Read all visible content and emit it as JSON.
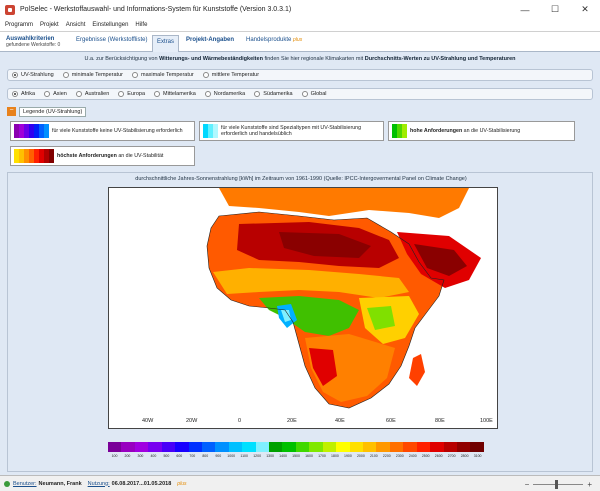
{
  "window": {
    "title": "PolSelec - Werkstoffauswahl- und Informations-System für Kunststoffe (Version 3.0.3.1)",
    "minimize": "—",
    "maximize": "☐",
    "close": "✕"
  },
  "menu": [
    "Programm",
    "Projekt",
    "Ansicht",
    "Einstellungen",
    "Hilfe"
  ],
  "tabs": [
    {
      "label": "Auswahlkriterien",
      "sub": "gefundene Werkstoffe: 0"
    },
    {
      "label": "Ergebnisse (Werkstoffliste)"
    },
    {
      "label": "Extras"
    },
    {
      "label": "Projekt-Angaben"
    },
    {
      "label": "Handelsprodukte",
      "plus": "plus"
    }
  ],
  "info": {
    "pre": "U.a. zur Berücksichtigung von ",
    "b1": "Witterungs- und Wärmebeständigkeiten",
    "mid": " finden Sie hier regionale Klimakarten mit ",
    "b2": "Durchschnitts-Werten zu UV-Strahlung und Temperaturen"
  },
  "measure_options": [
    {
      "label": "UV-Strahlung",
      "selected": true
    },
    {
      "label": "minimale Temperatur",
      "selected": false
    },
    {
      "label": "maximale Temperatur",
      "selected": false
    },
    {
      "label": "mittlere Temperatur",
      "selected": false
    }
  ],
  "region_options": [
    {
      "label": "Afrika",
      "selected": true
    },
    {
      "label": "Asien",
      "selected": false
    },
    {
      "label": "Australien",
      "selected": false
    },
    {
      "label": "Europa",
      "selected": false
    },
    {
      "label": "Mittelamerika",
      "selected": false
    },
    {
      "label": "Nordamerika",
      "selected": false
    },
    {
      "label": "Südamerika",
      "selected": false
    },
    {
      "label": "Global",
      "selected": false
    }
  ],
  "legend": {
    "toggle": "−",
    "title": "Legende (UV-Strahlung)",
    "items": [
      {
        "text": "für viele Kunststoffe keine UV-Stabilisierung erforderlich",
        "colors": [
          "#8b00b0",
          "#a000d8",
          "#6a00e8",
          "#3000f0",
          "#0020f8",
          "#0060ff",
          "#0090ff"
        ]
      },
      {
        "text": "für viele Kunststoffe sind Spezialtypen mit UV-Stabilisierung erforderlich und handelsüblich",
        "colors": [
          "#00d8ff",
          "#60f0ff",
          "#b0f8ff"
        ]
      },
      {
        "bold": "hohe Anforderungen",
        "text": " an die UV-Stabilisierung",
        "colors": [
          "#00c000",
          "#50d800",
          "#a0ec00"
        ]
      },
      {
        "bold": "höchste Anforderungen",
        "text": " an die UV-Stabilität",
        "colors": [
          "#ffe000",
          "#ffc000",
          "#ff9000",
          "#ff6000",
          "#ff2000",
          "#e00000",
          "#b00000",
          "#800000"
        ]
      }
    ]
  },
  "map": {
    "caption": "durchschnittliche Jahres-Sonnenstrahlung [kWh] im Zeitraum von 1961-1990 (Quelle: IPCC-Intergovermental Panel on Climate Change)",
    "xticks": [
      "40W",
      "20W",
      "0",
      "20E",
      "40E",
      "60E",
      "80E",
      "100E"
    ],
    "colorbar": {
      "colors": [
        "#7a0098",
        "#9800c0",
        "#a000e0",
        "#7800f0",
        "#4800f8",
        "#1800ff",
        "#0030ff",
        "#0060ff",
        "#0090ff",
        "#00c0ff",
        "#00e0ff",
        "#80f0ff",
        "#00a000",
        "#00c000",
        "#40d800",
        "#80e800",
        "#c0f000",
        "#ffff00",
        "#ffe000",
        "#ffc000",
        "#ff9800",
        "#ff7000",
        "#ff4800",
        "#ff2000",
        "#e00000",
        "#b80000",
        "#900000",
        "#700000"
      ],
      "labels": [
        "100",
        "200",
        "300",
        "400",
        "500",
        "600",
        "700",
        "800",
        "900",
        "1000",
        "1100",
        "1200",
        "1300",
        "1400",
        "1500",
        "1600",
        "1700",
        "1800",
        "1900",
        "2000",
        "2100",
        "2200",
        "2300",
        "2400",
        "2500",
        "2600",
        "2700",
        "2800",
        "3100"
      ]
    }
  },
  "status": {
    "user_label": "Benutzer:",
    "user": "Neumann, Frank",
    "usage_label": "Nutzung:",
    "usage": "06.08.2017...01.05.2018",
    "plus": "plus",
    "zoom_minus": "−",
    "zoom_plus": "+"
  }
}
